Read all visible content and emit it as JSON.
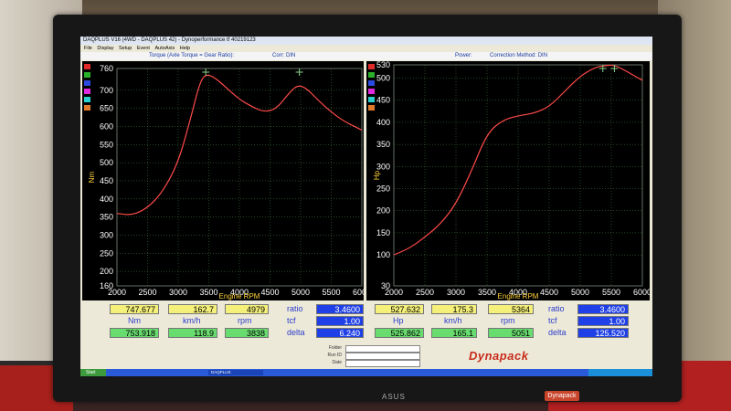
{
  "window": {
    "title": "DAQPLUS V16 (4WD - DAQPLUS 42) - Dynoperformance tf 40219123",
    "menu": [
      "File",
      "Display",
      "Setup",
      "Event",
      "AutoAxis",
      "Help"
    ]
  },
  "infobar": {
    "torque_label": "Torque (Axle Torque = Gear Ratio):",
    "corr_left": "Corr: DIN",
    "power_label": "Power:",
    "corr_right": "Correction Method: DIN"
  },
  "colors": {
    "curve": "#ff4a4a",
    "grid": "#4a8a4a",
    "peak_marker": "#8ad08a",
    "legend": [
      "#e02a2a",
      "#2ab02a",
      "#2a4ae0",
      "#e02ae0",
      "#2ad0d0",
      "#e07a2a"
    ]
  },
  "chart_data": [
    {
      "type": "line",
      "xlabel": "Engine RPM",
      "ylabel": "Nm",
      "x_ticks": [
        2000,
        2500,
        3000,
        3500,
        4000,
        4500,
        5000,
        5500,
        6000
      ],
      "y_ticks": [
        160,
        200,
        250,
        300,
        350,
        400,
        450,
        500,
        550,
        600,
        650,
        700,
        760
      ],
      "xlim": [
        2000,
        6000
      ],
      "ylim": [
        160,
        760
      ],
      "grid": true,
      "series": [
        {
          "x": [
            2000,
            2250,
            2500,
            2750,
            3000,
            3200,
            3350,
            3450,
            3600,
            3800,
            4000,
            4200,
            4400,
            4600,
            4800,
            4950,
            5100,
            5300,
            5500,
            5700,
            6000
          ],
          "y": [
            360,
            355,
            375,
            420,
            500,
            620,
            720,
            745,
            735,
            705,
            675,
            655,
            640,
            648,
            690,
            715,
            705,
            670,
            640,
            615,
            590
          ]
        }
      ],
      "markers": [
        3450,
        4979
      ]
    },
    {
      "type": "line",
      "xlabel": "Engine RPM",
      "ylabel": "Hp",
      "x_ticks": [
        2000,
        2500,
        3000,
        3500,
        4000,
        4500,
        5000,
        5500,
        6000
      ],
      "y_ticks": [
        30,
        100,
        150,
        200,
        250,
        300,
        350,
        400,
        450,
        500,
        530
      ],
      "xlim": [
        2000,
        6000
      ],
      "ylim": [
        30,
        530
      ],
      "grid": true,
      "series": [
        {
          "x": [
            2000,
            2250,
            2500,
            2750,
            3000,
            3250,
            3500,
            3750,
            4000,
            4250,
            4500,
            4750,
            5000,
            5250,
            5400,
            5550,
            5750,
            6000
          ],
          "y": [
            100,
            115,
            140,
            170,
            215,
            290,
            375,
            405,
            415,
            420,
            435,
            470,
            505,
            525,
            528,
            530,
            515,
            495
          ]
        }
      ],
      "markers": [
        5364,
        5550
      ]
    }
  ],
  "readouts": {
    "left": {
      "row1": [
        "747.677",
        "162.7",
        "4979"
      ],
      "row2": [
        "753.918",
        "118.9",
        "3838"
      ],
      "units": [
        "Nm",
        "km/h",
        "rpm"
      ],
      "ratio_label": "ratio",
      "ratio": "3.4600",
      "tcf_label": "tcf",
      "tcf": "1.00",
      "delta_label": "delta",
      "delta": "6.240"
    },
    "right": {
      "row1": [
        "527.632",
        "175.3",
        "5364"
      ],
      "row2": [
        "525.862",
        "165.1",
        "5051"
      ],
      "units": [
        "Hp",
        "km/h",
        "rpm"
      ],
      "ratio_label": "ratio",
      "ratio": "3.4600",
      "tcf_label": "tcf",
      "tcf": "1.00",
      "delta_label": "delta",
      "delta": "125.520"
    }
  },
  "bottom": {
    "fields": [
      "Folder",
      "Run ID",
      "Date"
    ],
    "logo": "Dynapack"
  },
  "taskbar": {
    "start": "Start",
    "app": "DAQPLUS"
  },
  "monitor": {
    "brand": "ASUS",
    "badge": "Dynapack"
  }
}
